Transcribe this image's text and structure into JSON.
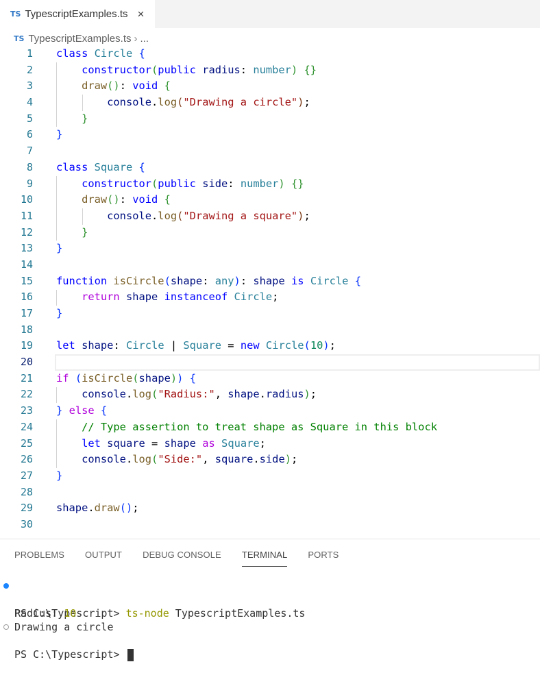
{
  "tab": {
    "badge": "TS",
    "title": "TypescriptExamples.ts",
    "close_icon": "×"
  },
  "breadcrumb": {
    "badge": "TS",
    "file": "TypescriptExamples.ts",
    "separator": "›",
    "more": "..."
  },
  "editor": {
    "current_line": 20,
    "lines": [
      {
        "n": "1",
        "tokens": [
          [
            "k",
            "class"
          ],
          [
            "o",
            " "
          ],
          [
            "t",
            "Circle"
          ],
          [
            "o",
            " "
          ],
          [
            "b1",
            "{"
          ]
        ]
      },
      {
        "n": "2",
        "tokens": [
          [
            "o",
            "    "
          ],
          [
            "k",
            "constructor"
          ],
          [
            "b2",
            "("
          ],
          [
            "k",
            "public"
          ],
          [
            "o",
            " "
          ],
          [
            "v",
            "radius"
          ],
          [
            "o",
            ": "
          ],
          [
            "t",
            "number"
          ],
          [
            "b2",
            ")"
          ],
          [
            "o",
            " "
          ],
          [
            "b2",
            "{}"
          ]
        ]
      },
      {
        "n": "3",
        "tokens": [
          [
            "o",
            "    "
          ],
          [
            "f",
            "draw"
          ],
          [
            "b2",
            "()"
          ],
          [
            "o",
            ": "
          ],
          [
            "k",
            "void"
          ],
          [
            "o",
            " "
          ],
          [
            "b2",
            "{"
          ]
        ]
      },
      {
        "n": "4",
        "tokens": [
          [
            "o",
            "        "
          ],
          [
            "v",
            "console"
          ],
          [
            "o",
            "."
          ],
          [
            "f",
            "log"
          ],
          [
            "b3",
            "("
          ],
          [
            "s",
            "\"Drawing a circle\""
          ],
          [
            "b3",
            ")"
          ],
          [
            "o",
            ";"
          ]
        ]
      },
      {
        "n": "5",
        "tokens": [
          [
            "o",
            "    "
          ],
          [
            "b2",
            "}"
          ]
        ]
      },
      {
        "n": "6",
        "tokens": [
          [
            "b1",
            "}"
          ]
        ]
      },
      {
        "n": "7",
        "tokens": []
      },
      {
        "n": "8",
        "tokens": [
          [
            "k",
            "class"
          ],
          [
            "o",
            " "
          ],
          [
            "t",
            "Square"
          ],
          [
            "o",
            " "
          ],
          [
            "b1",
            "{"
          ]
        ]
      },
      {
        "n": "9",
        "tokens": [
          [
            "o",
            "    "
          ],
          [
            "k",
            "constructor"
          ],
          [
            "b2",
            "("
          ],
          [
            "k",
            "public"
          ],
          [
            "o",
            " "
          ],
          [
            "v",
            "side"
          ],
          [
            "o",
            ": "
          ],
          [
            "t",
            "number"
          ],
          [
            "b2",
            ")"
          ],
          [
            "o",
            " "
          ],
          [
            "b2",
            "{}"
          ]
        ]
      },
      {
        "n": "10",
        "tokens": [
          [
            "o",
            "    "
          ],
          [
            "f",
            "draw"
          ],
          [
            "b2",
            "()"
          ],
          [
            "o",
            ": "
          ],
          [
            "k",
            "void"
          ],
          [
            "o",
            " "
          ],
          [
            "b2",
            "{"
          ]
        ]
      },
      {
        "n": "11",
        "tokens": [
          [
            "o",
            "        "
          ],
          [
            "v",
            "console"
          ],
          [
            "o",
            "."
          ],
          [
            "f",
            "log"
          ],
          [
            "b3",
            "("
          ],
          [
            "s",
            "\"Drawing a square\""
          ],
          [
            "b3",
            ")"
          ],
          [
            "o",
            ";"
          ]
        ]
      },
      {
        "n": "12",
        "tokens": [
          [
            "o",
            "    "
          ],
          [
            "b2",
            "}"
          ]
        ]
      },
      {
        "n": "13",
        "tokens": [
          [
            "b1",
            "}"
          ]
        ]
      },
      {
        "n": "14",
        "tokens": []
      },
      {
        "n": "15",
        "tokens": [
          [
            "k",
            "function"
          ],
          [
            "o",
            " "
          ],
          [
            "f",
            "isCircle"
          ],
          [
            "b1",
            "("
          ],
          [
            "v",
            "shape"
          ],
          [
            "o",
            ": "
          ],
          [
            "t",
            "any"
          ],
          [
            "b1",
            ")"
          ],
          [
            "o",
            ": "
          ],
          [
            "v",
            "shape"
          ],
          [
            "o",
            " "
          ],
          [
            "k",
            "is"
          ],
          [
            "o",
            " "
          ],
          [
            "t",
            "Circle"
          ],
          [
            "o",
            " "
          ],
          [
            "b1",
            "{"
          ]
        ]
      },
      {
        "n": "16",
        "tokens": [
          [
            "o",
            "    "
          ],
          [
            "p",
            "return"
          ],
          [
            "o",
            " "
          ],
          [
            "v",
            "shape"
          ],
          [
            "o",
            " "
          ],
          [
            "k",
            "instanceof"
          ],
          [
            "o",
            " "
          ],
          [
            "t",
            "Circle"
          ],
          [
            "o",
            ";"
          ]
        ]
      },
      {
        "n": "17",
        "tokens": [
          [
            "b1",
            "}"
          ]
        ]
      },
      {
        "n": "18",
        "tokens": []
      },
      {
        "n": "19",
        "tokens": [
          [
            "k",
            "let"
          ],
          [
            "o",
            " "
          ],
          [
            "v",
            "shape"
          ],
          [
            "o",
            ": "
          ],
          [
            "t",
            "Circle"
          ],
          [
            "o",
            " | "
          ],
          [
            "t",
            "Square"
          ],
          [
            "o",
            " = "
          ],
          [
            "k",
            "new"
          ],
          [
            "o",
            " "
          ],
          [
            "t",
            "Circle"
          ],
          [
            "b1",
            "("
          ],
          [
            "n",
            "10"
          ],
          [
            "b1",
            ")"
          ],
          [
            "o",
            ";"
          ]
        ]
      },
      {
        "n": "20",
        "tokens": []
      },
      {
        "n": "21",
        "tokens": [
          [
            "p",
            "if"
          ],
          [
            "o",
            " "
          ],
          [
            "b1",
            "("
          ],
          [
            "f",
            "isCircle"
          ],
          [
            "b2",
            "("
          ],
          [
            "v",
            "shape"
          ],
          [
            "b2",
            ")"
          ],
          [
            "b1",
            ")"
          ],
          [
            "o",
            " "
          ],
          [
            "b1",
            "{"
          ]
        ]
      },
      {
        "n": "22",
        "tokens": [
          [
            "o",
            "    "
          ],
          [
            "v",
            "console"
          ],
          [
            "o",
            "."
          ],
          [
            "f",
            "log"
          ],
          [
            "b2",
            "("
          ],
          [
            "s",
            "\"Radius:\""
          ],
          [
            "o",
            ", "
          ],
          [
            "v",
            "shape"
          ],
          [
            "o",
            "."
          ],
          [
            "v",
            "radius"
          ],
          [
            "b2",
            ")"
          ],
          [
            "o",
            ";"
          ]
        ]
      },
      {
        "n": "23",
        "tokens": [
          [
            "b1",
            "}"
          ],
          [
            "o",
            " "
          ],
          [
            "p",
            "else"
          ],
          [
            "o",
            " "
          ],
          [
            "b1",
            "{"
          ]
        ]
      },
      {
        "n": "24",
        "tokens": [
          [
            "o",
            "    "
          ],
          [
            "c",
            "// Type assertion to treat shape as Square in this block"
          ]
        ]
      },
      {
        "n": "25",
        "tokens": [
          [
            "o",
            "    "
          ],
          [
            "k",
            "let"
          ],
          [
            "o",
            " "
          ],
          [
            "v",
            "square"
          ],
          [
            "o",
            " = "
          ],
          [
            "v",
            "shape"
          ],
          [
            "o",
            " "
          ],
          [
            "p",
            "as"
          ],
          [
            "o",
            " "
          ],
          [
            "t",
            "Square"
          ],
          [
            "o",
            ";"
          ]
        ]
      },
      {
        "n": "26",
        "tokens": [
          [
            "o",
            "    "
          ],
          [
            "v",
            "console"
          ],
          [
            "o",
            "."
          ],
          [
            "f",
            "log"
          ],
          [
            "b2",
            "("
          ],
          [
            "s",
            "\"Side:\""
          ],
          [
            "o",
            ", "
          ],
          [
            "v",
            "square"
          ],
          [
            "o",
            "."
          ],
          [
            "v",
            "side"
          ],
          [
            "b2",
            ")"
          ],
          [
            "o",
            ";"
          ]
        ]
      },
      {
        "n": "27",
        "tokens": [
          [
            "b1",
            "}"
          ]
        ]
      },
      {
        "n": "28",
        "tokens": []
      },
      {
        "n": "29",
        "tokens": [
          [
            "v",
            "shape"
          ],
          [
            "o",
            "."
          ],
          [
            "f",
            "draw"
          ],
          [
            "b1",
            "()"
          ],
          [
            "o",
            ";"
          ]
        ]
      },
      {
        "n": "30",
        "tokens": []
      }
    ]
  },
  "panel": {
    "tabs": [
      "PROBLEMS",
      "OUTPUT",
      "DEBUG CONSOLE",
      "TERMINAL",
      "PORTS"
    ],
    "active_tab": "TERMINAL",
    "terminal": {
      "line1_prompt": "PS C:\\Typescript> ",
      "line1_cmd": "ts-node",
      "line1_arg": " TypescriptExamples.ts",
      "line2_label": "Radius: ",
      "line2_value": "10",
      "line3": "Drawing a circle",
      "line4_prompt": "PS C:\\Typescript> "
    }
  }
}
